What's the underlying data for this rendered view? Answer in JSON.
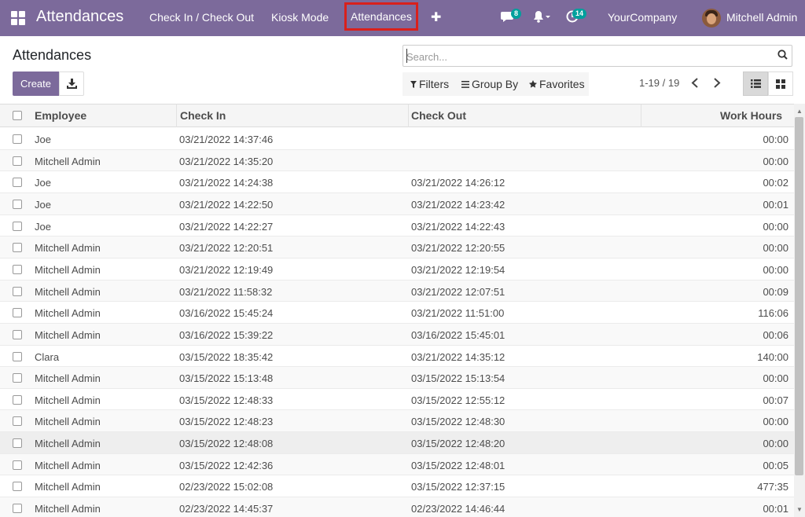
{
  "navbar": {
    "brand": "Attendances",
    "menu": [
      "Check In / Check Out",
      "Kiosk Mode",
      "Attendances"
    ],
    "messages_count": "8",
    "activities_count": "14",
    "company": "YourCompany",
    "user": "Mitchell Admin",
    "color": "#7c6a9b",
    "highlight_color": "#d9201c"
  },
  "control": {
    "title": "Attendances",
    "search_placeholder": "Search...",
    "create_label": "Create",
    "filters_label": "Filters",
    "groupby_label": "Group By",
    "favorites_label": "Favorites",
    "pager": "1-19 / 19"
  },
  "table": {
    "headers": [
      "Employee",
      "Check In",
      "Check Out",
      "Work Hours"
    ],
    "rows": [
      [
        "Joe",
        "03/21/2022 14:37:46",
        "",
        "00:00"
      ],
      [
        "Mitchell Admin",
        "03/21/2022 14:35:20",
        "",
        "00:00"
      ],
      [
        "Joe",
        "03/21/2022 14:24:38",
        "03/21/2022 14:26:12",
        "00:02"
      ],
      [
        "Joe",
        "03/21/2022 14:22:50",
        "03/21/2022 14:23:42",
        "00:01"
      ],
      [
        "Joe",
        "03/21/2022 14:22:27",
        "03/21/2022 14:22:43",
        "00:00"
      ],
      [
        "Mitchell Admin",
        "03/21/2022 12:20:51",
        "03/21/2022 12:20:55",
        "00:00"
      ],
      [
        "Mitchell Admin",
        "03/21/2022 12:19:49",
        "03/21/2022 12:19:54",
        "00:00"
      ],
      [
        "Mitchell Admin",
        "03/21/2022 11:58:32",
        "03/21/2022 12:07:51",
        "00:09"
      ],
      [
        "Mitchell Admin",
        "03/16/2022 15:45:24",
        "03/21/2022 11:51:00",
        "116:06"
      ],
      [
        "Mitchell Admin",
        "03/16/2022 15:39:22",
        "03/16/2022 15:45:01",
        "00:06"
      ],
      [
        "Clara",
        "03/15/2022 18:35:42",
        "03/21/2022 14:35:12",
        "140:00"
      ],
      [
        "Mitchell Admin",
        "03/15/2022 15:13:48",
        "03/15/2022 15:13:54",
        "00:00"
      ],
      [
        "Mitchell Admin",
        "03/15/2022 12:48:33",
        "03/15/2022 12:55:12",
        "00:07"
      ],
      [
        "Mitchell Admin",
        "03/15/2022 12:48:23",
        "03/15/2022 12:48:30",
        "00:00"
      ],
      [
        "Mitchell Admin",
        "03/15/2022 12:48:08",
        "03/15/2022 12:48:20",
        "00:00"
      ],
      [
        "Mitchell Admin",
        "03/15/2022 12:42:36",
        "03/15/2022 12:48:01",
        "00:05"
      ],
      [
        "Mitchell Admin",
        "02/23/2022 15:02:08",
        "03/15/2022 12:37:15",
        "477:35"
      ],
      [
        "Mitchell Admin",
        "02/23/2022 14:45:37",
        "02/23/2022 14:46:44",
        "00:01"
      ]
    ]
  }
}
